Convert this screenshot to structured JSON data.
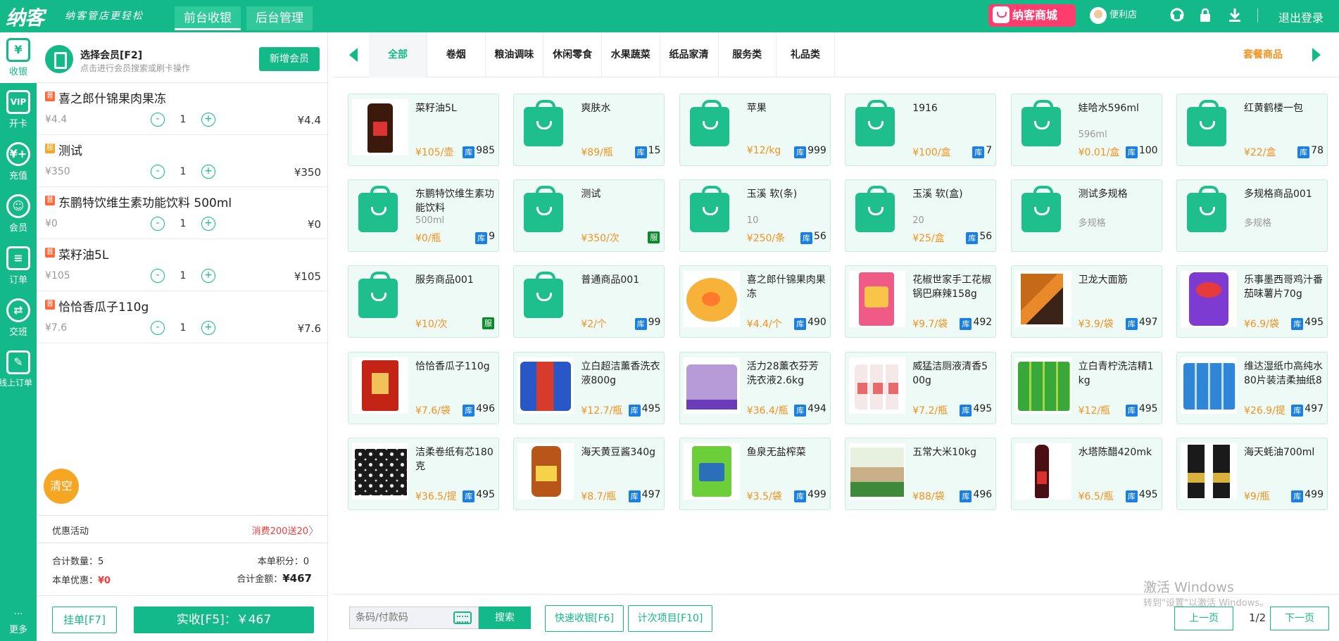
{
  "topbar": {
    "logo": "纳客",
    "slogan": "纳客管店更轻松",
    "tabs": [
      {
        "label": "前台收银",
        "active": true
      },
      {
        "label": "后台管理",
        "active": false
      }
    ],
    "mall_label": "纳客商城",
    "user_label": "便利店",
    "logout_label": "退出登录",
    "icons": [
      "headset-icon",
      "lock-icon",
      "download-icon"
    ]
  },
  "leftnav": {
    "items": [
      {
        "label": "收银",
        "icon": "cashier-icon",
        "glyph": "¥",
        "active": true
      },
      {
        "label": "开卡",
        "icon": "vip-card-icon",
        "glyph": "VIP"
      },
      {
        "label": "充值",
        "icon": "recharge-icon",
        "glyph": "¥+"
      },
      {
        "label": "会员",
        "icon": "member-icon",
        "glyph": "☺"
      },
      {
        "label": "订单",
        "icon": "order-icon",
        "glyph": "≡"
      },
      {
        "label": "交班",
        "icon": "shift-icon",
        "glyph": "⇄"
      },
      {
        "label": "线上订单",
        "icon": "online-order-icon",
        "glyph": "✎"
      }
    ],
    "more_label": "更多",
    "more_dots": "···"
  },
  "member": {
    "title": "选择会员[F2]",
    "subtitle": "点击进行会员搜索或刷卡操作",
    "add_button": "新增会员"
  },
  "cart": {
    "items": [
      {
        "tag": "普",
        "tag_type": "pu",
        "name": "喜之郎什锦果肉果冻",
        "price": "¥4.4",
        "qty": "1",
        "total": "¥4.4"
      },
      {
        "tag": "服",
        "tag_type": "fu",
        "name": "测试",
        "price": "¥350",
        "qty": "1",
        "total": "¥350"
      },
      {
        "tag": "普",
        "tag_type": "pu",
        "name": "东鹏特饮维生素功能饮料 500ml",
        "price": "¥0",
        "qty": "1",
        "total": "¥0"
      },
      {
        "tag": "普",
        "tag_type": "pu",
        "name": "菜籽油5L",
        "price": "¥105",
        "qty": "1",
        "total": "¥105"
      },
      {
        "tag": "普",
        "tag_type": "pu",
        "name": "恰恰香瓜子110g",
        "price": "¥7.6",
        "qty": "1",
        "total": "¥7.6"
      }
    ],
    "minus": "-",
    "plus": "+",
    "clear_label": "清空",
    "promo_label": "优惠活动",
    "promo_value": "消费200送20",
    "promo_chevron": "〉",
    "count_label": "合计数量：",
    "count_value": "5",
    "points_label": "本单积分：",
    "points_value": "0",
    "discount_label": "本单优惠：",
    "discount_value": "¥0",
    "amount_label": "合计金额：",
    "amount_value": "¥467",
    "hold_button": "挂单[F7]",
    "pay_button": "实收[F5]：￥467"
  },
  "categories": {
    "items": [
      "全部",
      "卷烟",
      "粮油调味",
      "休闲零食",
      "水果蔬菜",
      "纸品家清",
      "服务类",
      "礼品类"
    ],
    "active_index": 0,
    "combo_label": "套餐商品"
  },
  "products": [
    {
      "name": "菜籽油5L",
      "spec": "",
      "price": "¥105/壶",
      "stock": "985",
      "thumb": "t-oil",
      "service": false
    },
    {
      "name": "爽肤水",
      "spec": "",
      "price": "¥89/瓶",
      "stock": "15",
      "thumb": "bag",
      "service": false
    },
    {
      "name": "苹果",
      "spec": "",
      "price": "¥12/kg",
      "stock": "999",
      "thumb": "bag",
      "service": false
    },
    {
      "name": "1916",
      "spec": "",
      "price": "¥100/盒",
      "stock": "7",
      "thumb": "bag",
      "service": false
    },
    {
      "name": "娃哈水596ml",
      "spec": "596ml",
      "price": "¥0.01/盒",
      "stock": "100",
      "thumb": "bag",
      "service": false
    },
    {
      "name": "红黄鹤楼一包",
      "spec": "",
      "price": "¥22/盒",
      "stock": "78",
      "thumb": "bag",
      "service": false
    },
    {
      "name": "东鹏特饮维生素功能饮料",
      "spec": "500ml",
      "price": "¥0/瓶",
      "stock": "9",
      "thumb": "bag",
      "service": false
    },
    {
      "name": "测试",
      "spec": "",
      "price": "¥350/次",
      "stock": "",
      "thumb": "bag",
      "service": true
    },
    {
      "name": "玉溪 软(条)",
      "spec": "10",
      "price": "¥250/条",
      "stock": "56",
      "thumb": "bag",
      "service": false
    },
    {
      "name": "玉溪 软(盒)",
      "spec": "20",
      "price": "¥25/盒",
      "stock": "56",
      "thumb": "bag",
      "service": false
    },
    {
      "name": "测试多规格",
      "spec": "多规格",
      "price": "",
      "stock": "",
      "thumb": "bag",
      "service": false
    },
    {
      "name": "多规格商品001",
      "spec": "多规格",
      "price": "",
      "stock": "",
      "thumb": "bag",
      "service": false
    },
    {
      "name": "服务商品001",
      "spec": "",
      "price": "¥10/次",
      "stock": "",
      "thumb": "bag",
      "service": true
    },
    {
      "name": "普通商品001",
      "spec": "",
      "price": "¥2/个",
      "stock": "99",
      "thumb": "bag",
      "service": false
    },
    {
      "name": "喜之郎什锦果肉果冻",
      "spec": "",
      "price": "¥4.4/个",
      "stock": "490",
      "thumb": "t-jelly",
      "service": false
    },
    {
      "name": "花椒世家手工花椒锅巴麻辣158g",
      "spec": "",
      "price": "¥9.7/袋",
      "stock": "492",
      "thumb": "t-bag-pink",
      "service": false
    },
    {
      "name": "卫龙大面筋",
      "spec": "",
      "price": "¥3.9/袋",
      "stock": "497",
      "thumb": "t-stick",
      "service": false
    },
    {
      "name": "乐事墨西哥鸡汁番茄味薯片70g",
      "spec": "",
      "price": "¥6.9/袋",
      "stock": "495",
      "thumb": "t-chips",
      "service": false
    },
    {
      "name": "恰恰香瓜子110g",
      "spec": "",
      "price": "¥7.6/袋",
      "stock": "496",
      "thumb": "t-seed",
      "service": false
    },
    {
      "name": "立白超洁薰香洗衣液800g",
      "spec": "",
      "price": "¥12.7/瓶",
      "stock": "495",
      "thumb": "t-det-blue",
      "service": false
    },
    {
      "name": "活力28薰衣芬芳洗衣液2.6kg",
      "spec": "",
      "price": "¥36.4/瓶",
      "stock": "494",
      "thumb": "t-det-purple",
      "service": false
    },
    {
      "name": "威猛洁厕液清香500g",
      "spec": "",
      "price": "¥7.2/瓶",
      "stock": "495",
      "thumb": "t-bottles",
      "service": false
    },
    {
      "name": "立白青柠洗洁精1kg",
      "spec": "",
      "price": "¥12/瓶",
      "stock": "495",
      "thumb": "t-green",
      "service": false
    },
    {
      "name": "维达湿纸巾高纯水80片装洁柔抽纸8",
      "spec": "",
      "price": "¥26.9/提",
      "stock": "497",
      "thumb": "t-wipes",
      "service": false
    },
    {
      "name": "洁柔卷纸有芯180克",
      "spec": "",
      "price": "¥36.5/提",
      "stock": "495",
      "thumb": "t-rolls",
      "service": false
    },
    {
      "name": "海天黄豆酱340g",
      "spec": "",
      "price": "¥8.7/瓶",
      "stock": "497",
      "thumb": "t-jar",
      "service": false
    },
    {
      "name": "鱼泉无盐榨菜",
      "spec": "",
      "price": "¥3.5/袋",
      "stock": "499",
      "thumb": "t-pickle",
      "service": false
    },
    {
      "name": "五常大米10kg",
      "spec": "",
      "price": "¥88/袋",
      "stock": "496",
      "thumb": "t-rice",
      "service": false
    },
    {
      "name": "水塔陈醋420mk",
      "spec": "",
      "price": "¥6.5/瓶",
      "stock": "495",
      "thumb": "t-vinegar",
      "service": false
    },
    {
      "name": "海天蚝油700ml",
      "spec": "",
      "price": "¥9/瓶",
      "stock": "499",
      "thumb": "t-oyster",
      "service": false
    }
  ],
  "stock_badge": "库",
  "service_badge": "服",
  "bottom": {
    "search_placeholder": "条码/付款码",
    "search_button": "搜索",
    "quick_button": "快速收银[F6]",
    "count_button": "计次项目[F10]",
    "prev_button": "上一页",
    "next_button": "下一页",
    "page_text": "1/2"
  },
  "watermark": {
    "line1": "激活 Windows",
    "line2": "转到\"设置\"以激活 Windows。"
  },
  "colors": {
    "brand": "#13b988",
    "price": "#f5911e",
    "danger": "#f23b3b",
    "stock_badge": "#1a7fe0"
  }
}
